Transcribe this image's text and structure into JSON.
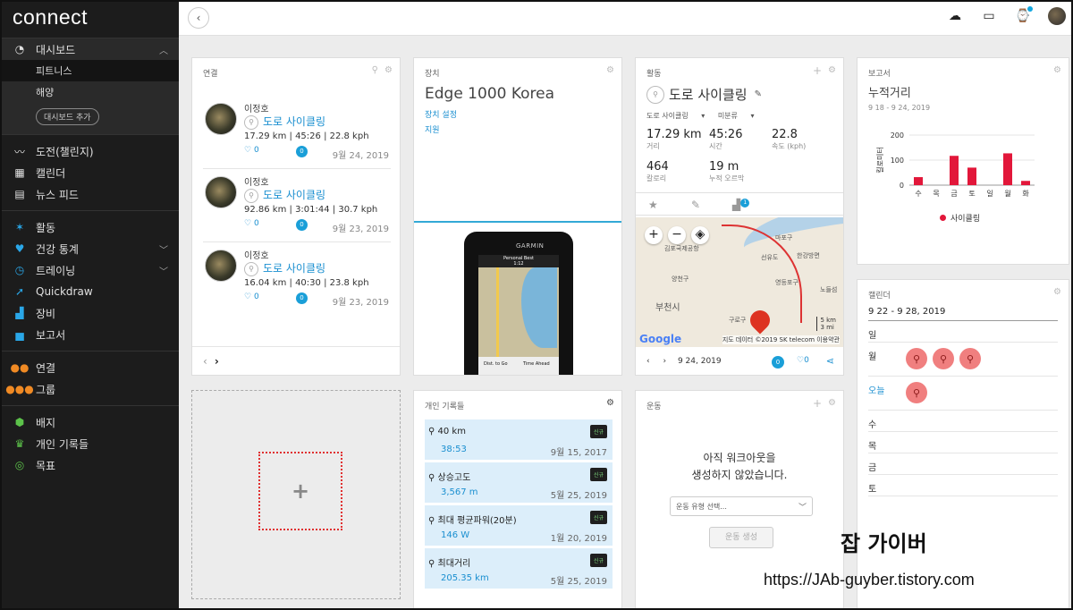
{
  "app": {
    "logo": "connect"
  },
  "sidebar": {
    "dashboard": {
      "label": "대시보드",
      "subs": [
        "피트니스",
        "해양"
      ],
      "add_label": "대시보드 추가"
    },
    "group1": [
      "도전(챌린지)",
      "캘린더",
      "뉴스 피드"
    ],
    "group2": [
      "활동",
      "건강 통계",
      "트레이닝",
      "Quickdraw",
      "장비",
      "보고서"
    ],
    "group3": [
      "연결",
      "그룹"
    ],
    "group4": [
      "배지",
      "개인 기록들",
      "목표"
    ],
    "icons": [
      "dashboard-icon",
      "challenge-icon",
      "calendar-icon",
      "news-icon",
      "activity-icon",
      "heart-icon",
      "stopwatch-icon",
      "quickdraw-icon",
      "shoe-icon",
      "report-icon",
      "connections-icon",
      "groups-icon",
      "badge-icon",
      "trophy-icon",
      "target-icon"
    ]
  },
  "connections": {
    "title": "연결",
    "items": [
      {
        "name": "이정호",
        "activity": "도로 사이클링",
        "stats": "17.29 km | 45:26 | 22.8 kph",
        "likes": "0",
        "comments": "0",
        "date": "9월 24, 2019"
      },
      {
        "name": "이정호",
        "activity": "도로 사이클링",
        "stats": "92.86 km | 3:01:44 | 30.7 kph",
        "likes": "0",
        "comments": "0",
        "date": "9월 23, 2019"
      },
      {
        "name": "이정호",
        "activity": "도로 사이클링",
        "stats": "16.04 km | 40:30 | 23.8 kph",
        "likes": "0",
        "comments": "0",
        "date": "9월 23, 2019"
      }
    ]
  },
  "device": {
    "header": "장치",
    "name": "Edge 1000 Korea",
    "links": [
      "장치 설정",
      "지원"
    ],
    "screen": {
      "brand": "GARMIN",
      "banner": "Personal Best",
      "banner_sub": "1:12",
      "labels": [
        "Dist. to Go",
        "Time Ahead"
      ]
    }
  },
  "activity": {
    "header": "활동",
    "title": "도로 사이클링",
    "type": "도로 사이클링",
    "category": "미분류",
    "stats": [
      {
        "value": "17.29 km",
        "label": "거리"
      },
      {
        "value": "45:26",
        "label": "시간"
      },
      {
        "value": "22.8",
        "label": "속도 (kph)"
      },
      {
        "value": "464",
        "label": "칼로리"
      },
      {
        "value": "19 m",
        "label": "누적 오르막"
      }
    ],
    "gear_badge": "1",
    "map": {
      "labels": [
        "김포국제공항",
        "마포구",
        "한강방면",
        "선유도",
        "영등포구",
        "양천구",
        "부천시",
        "구로구",
        "노들섬"
      ],
      "scale_km": "5 km",
      "scale_mi": "3 mi",
      "google": "Google",
      "credits": "지도 데이터 ©2019 SK telecom  이용약관"
    },
    "date": "9 24, 2019",
    "comments": "0",
    "likes": "0"
  },
  "reports": {
    "header": "보고서",
    "title": "누적거리",
    "range": "9 18 - 9 24, 2019",
    "legend": "사이클링"
  },
  "chart_data": {
    "type": "bar",
    "categories": [
      "수",
      "목",
      "금",
      "토",
      "일",
      "월",
      "화"
    ],
    "values": [
      32,
      0,
      117,
      70,
      0,
      127,
      17
    ],
    "ylabel": "킬로미터",
    "yticks": [
      0,
      100,
      200
    ],
    "ylim": [
      0,
      200
    ],
    "series": [
      {
        "name": "사이클링",
        "color": "#e2173a",
        "values": [
          32,
          0,
          117,
          70,
          0,
          127,
          17
        ]
      }
    ]
  },
  "calendar": {
    "header": "캘린더",
    "range": "9 22 - 9 28, 2019",
    "days": [
      "일",
      "월",
      "오늘",
      "수",
      "목",
      "금",
      "토"
    ],
    "today_index": 2,
    "activity_counts": [
      0,
      3,
      1,
      0,
      0,
      0,
      0
    ]
  },
  "records": {
    "header": "개인 기록들",
    "items": [
      {
        "name": "40 km",
        "value": "38:53",
        "date": "9월 15, 2017",
        "badge": "신규"
      },
      {
        "name": "상승고도",
        "value": "3,567 m",
        "date": "5월 25, 2019",
        "badge": "신규"
      },
      {
        "name": "최대 평균파워(20분)",
        "value": "146 W",
        "date": "1월 20, 2019",
        "badge": "신규"
      },
      {
        "name": "최대거리",
        "value": "205.35 km",
        "date": "5월 25, 2019",
        "badge": "신규"
      }
    ]
  },
  "workouts": {
    "header": "운동",
    "message_line1": "아직 워크아웃을",
    "message_line2": "생성하지 않았습니다.",
    "select_placeholder": "운동 유형 선택...",
    "create_button": "운동 생성"
  },
  "watermark": {
    "title": "잡 가이버",
    "url": "https://JAb-guyber.tistory.com"
  },
  "colors": {
    "accent": "#1a8fd0",
    "sidebar_bg": "#1c1c1c",
    "chart_bar": "#e2173a",
    "calendar_bubble": "#f07f7f"
  }
}
